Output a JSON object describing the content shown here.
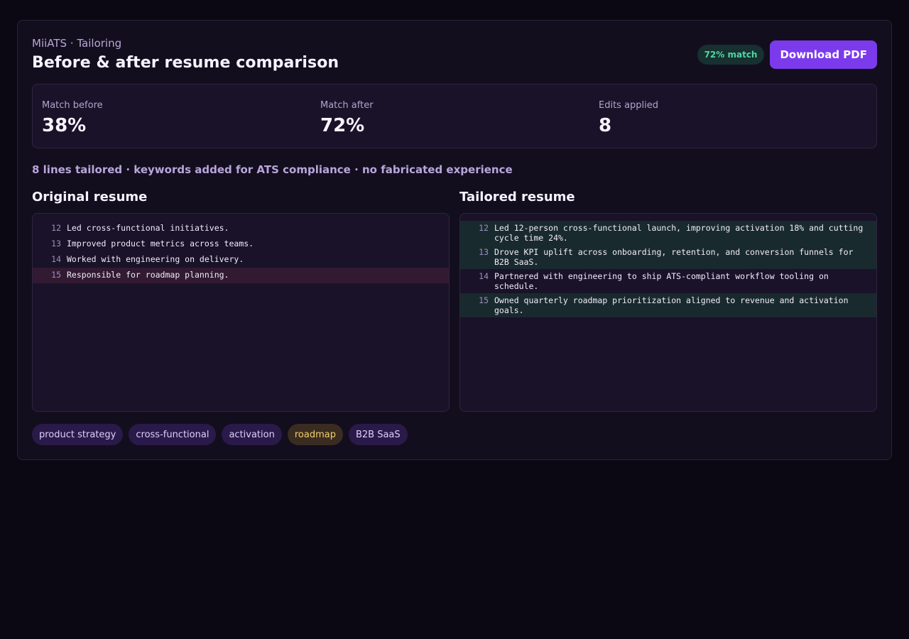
{
  "header": {
    "breadcrumb": "MiiATS · Tailoring",
    "title": "Before & after resume comparison",
    "match_badge": "72% match",
    "download_label": "Download PDF"
  },
  "stats": [
    {
      "label": "Match before",
      "value": "38%"
    },
    {
      "label": "Match after",
      "value": "72%"
    },
    {
      "label": "Edits applied",
      "value": "8"
    }
  ],
  "summary": "8 lines tailored · keywords added for ATS compliance · no fabricated experience",
  "original": {
    "title": "Original resume",
    "lines": [
      {
        "num": "12",
        "text": "Led cross-functional initiatives."
      },
      {
        "num": "13",
        "text": "Improved product metrics across teams."
      },
      {
        "num": "14",
        "text": "Worked with engineering on delivery."
      },
      {
        "num": "15",
        "text": "Responsible for roadmap planning."
      }
    ]
  },
  "tailored": {
    "title": "Tailored resume",
    "lines": [
      {
        "num": "12",
        "text": "Led 12-person cross-functional launch, improving activation 18% and cutting cycle time 24%."
      },
      {
        "num": "13",
        "text": "Drove KPI uplift across onboarding, retention, and conversion funnels for B2B SaaS."
      },
      {
        "num": "14",
        "text": "Partnered with engineering to ship ATS-compliant workflow tooling on schedule."
      },
      {
        "num": "15",
        "text": "Owned quarterly roadmap prioritization aligned to revenue and activation goals."
      }
    ]
  },
  "keywords": [
    "product strategy",
    "cross-functional",
    "activation",
    "roadmap",
    "B2B SaaS"
  ],
  "colors": {
    "accent": "#7c3aed",
    "match_green": "#4fd6a0",
    "removed_bg": "#311a32",
    "added_bg": "#192a2e",
    "warn_tag": "#f2cf6a"
  }
}
